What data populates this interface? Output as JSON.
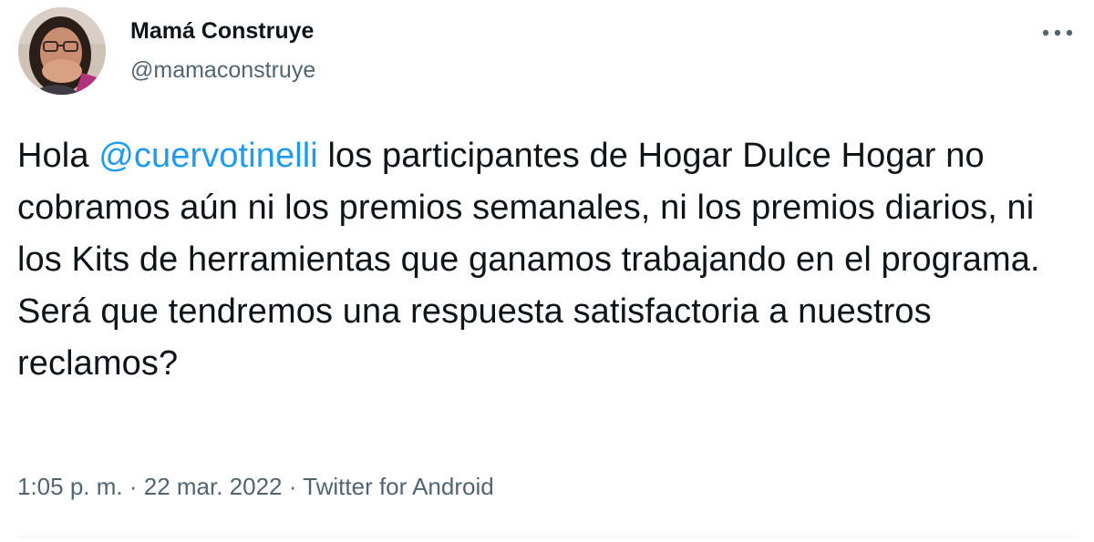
{
  "author": {
    "display_name": "Mamá Construye",
    "handle": "@mamaconstruye",
    "avatar_icon": "profile-photo"
  },
  "more_icon": "more-dots-icon",
  "tweet": {
    "text_before_mention": "Hola ",
    "mention": "@cuervotinelli",
    "text_after_mention": " los participantes de Hogar Dulce Hogar no cobramos aún ni los premios semanales, ni los premios diarios, ni los Kits de herramientas que ganamos trabajando en el programa. Será que tendremos una respuesta satisfactoria a nuestros reclamos?"
  },
  "meta": {
    "time": "1:05 p. m.",
    "separator": " · ",
    "date": "22 mar. 2022",
    "source": "Twitter for Android"
  },
  "colors": {
    "text": "#0f1419",
    "secondary": "#536471",
    "link": "#1d9bf0"
  }
}
